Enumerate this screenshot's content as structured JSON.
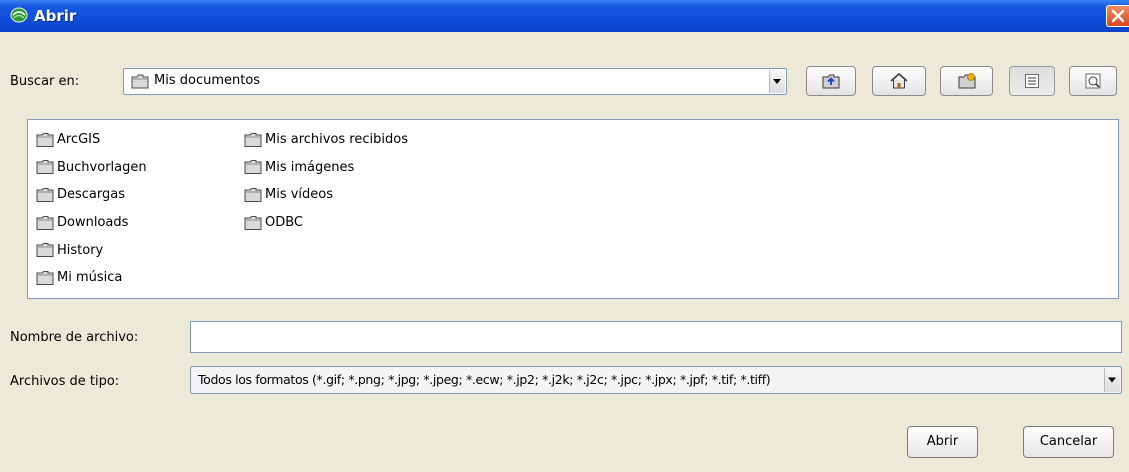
{
  "window": {
    "title": "Abrir",
    "icon": "app-logo-icon",
    "close_icon": "close-icon"
  },
  "toolbar": {
    "look_in_label": "Buscar en:",
    "look_in_value": "Mis documentos",
    "buttons": [
      {
        "icon": "up-folder-icon"
      },
      {
        "icon": "home-icon"
      },
      {
        "icon": "new-folder-icon"
      },
      {
        "icon": "list-view-icon",
        "pressed": true
      },
      {
        "icon": "details-view-icon"
      }
    ]
  },
  "files": {
    "column1": [
      "ArcGIS",
      "Buchvorlagen",
      "Descargas",
      "Downloads",
      "History",
      "Mi música"
    ],
    "column2": [
      "Mis archivos recibidos",
      "Mis imágenes",
      "Mis vídeos",
      "ODBC"
    ]
  },
  "filename": {
    "label": "Nombre de archivo:",
    "value": ""
  },
  "filetype": {
    "label": "Archivos de tipo:",
    "value": "Todos los formatos (*.gif; *.png; *.jpg; *.jpeg; *.ecw; *.jp2; *.j2k; *.j2c; *.jpc; *.jpx; *.jpf; *.tif; *.tiff)"
  },
  "actions": {
    "open_label": "Abrir",
    "cancel_label": "Cancelar"
  },
  "colors": {
    "titlebar": "#0f4fdb",
    "dialog_bg": "#ece9d8",
    "field_border": "#7f9db9",
    "close_button": "#d8461d"
  }
}
